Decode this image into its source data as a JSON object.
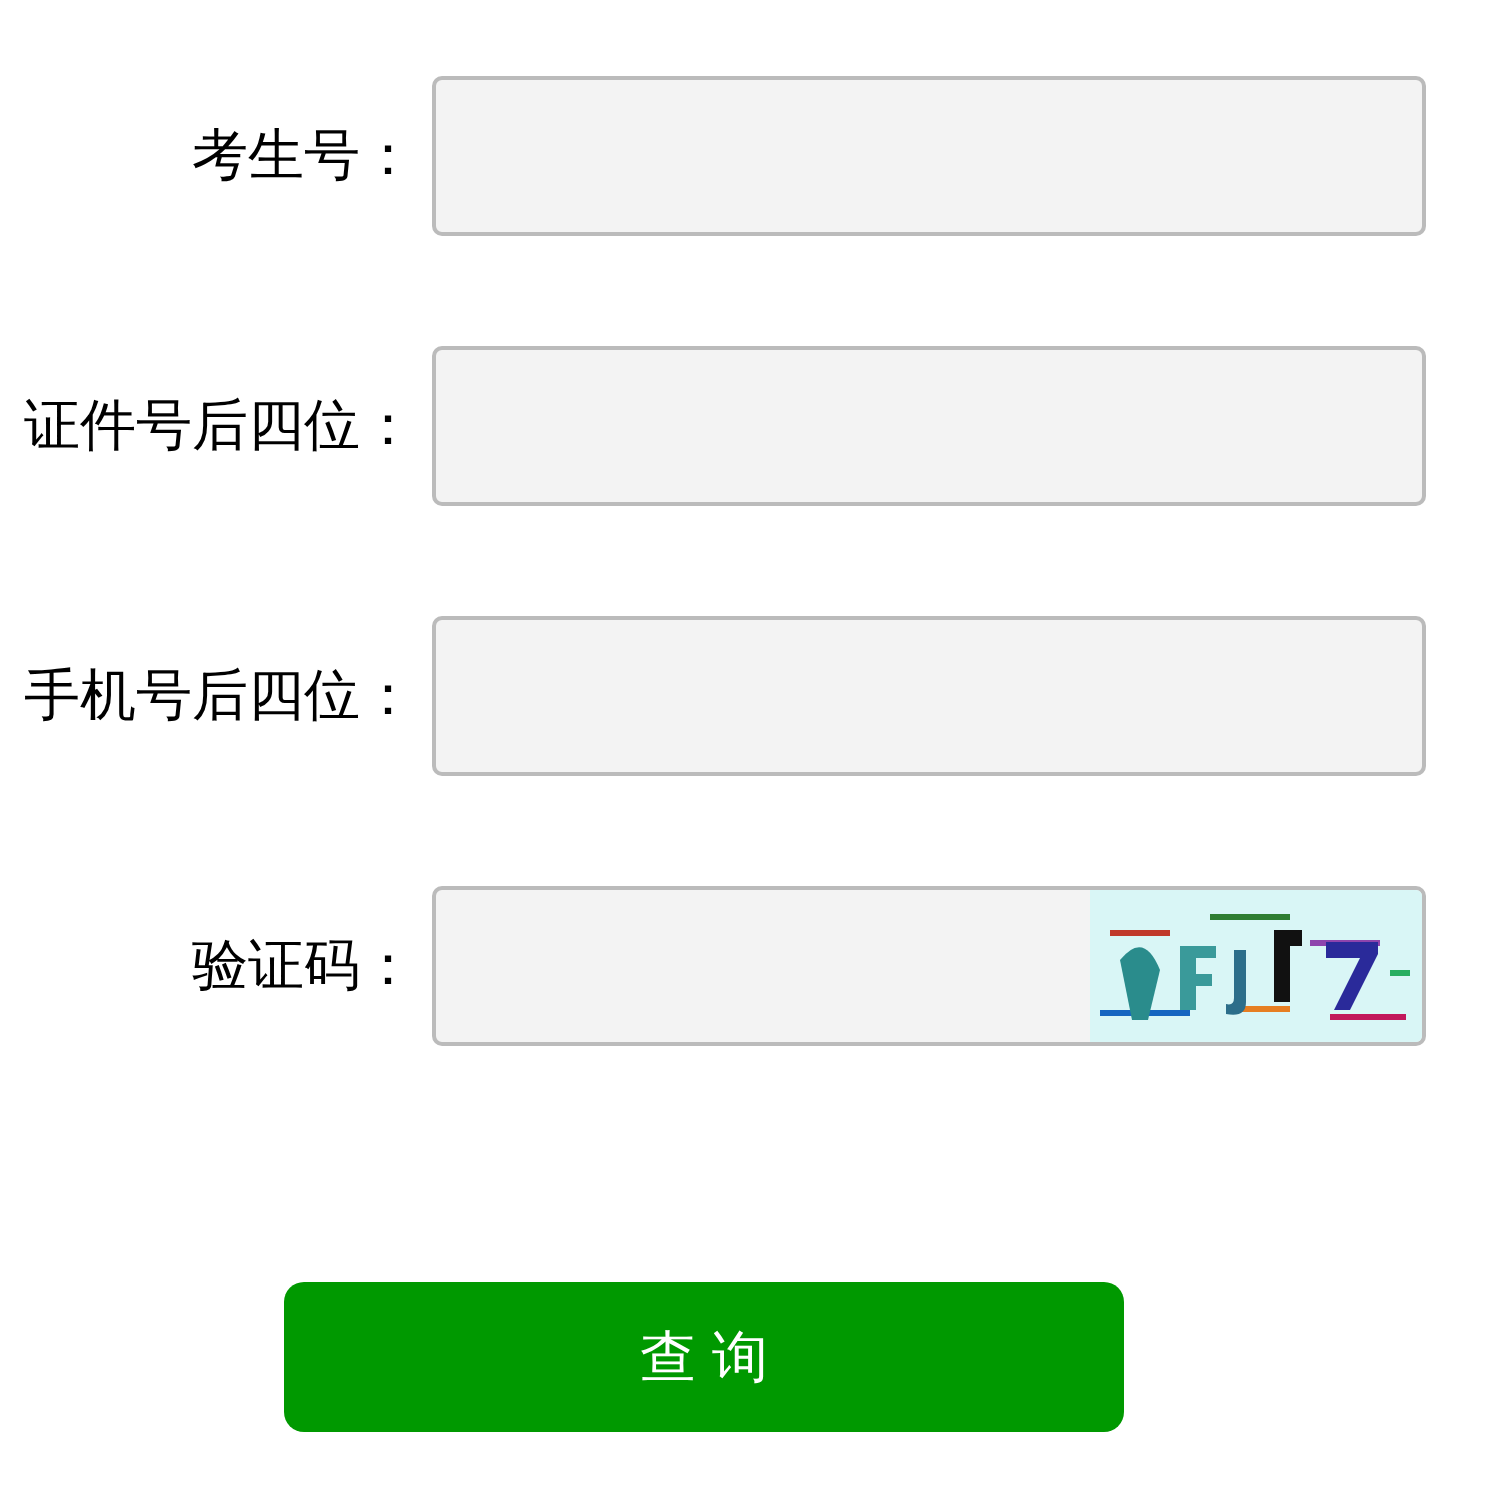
{
  "fields": [
    {
      "label": "考生号：",
      "kind": "text"
    },
    {
      "label": "证件号后四位：",
      "kind": "text"
    },
    {
      "label": "手机号后四位：",
      "kind": "text"
    },
    {
      "label": "验证码：",
      "kind": "captcha"
    }
  ],
  "submit": {
    "label": "查 询"
  }
}
